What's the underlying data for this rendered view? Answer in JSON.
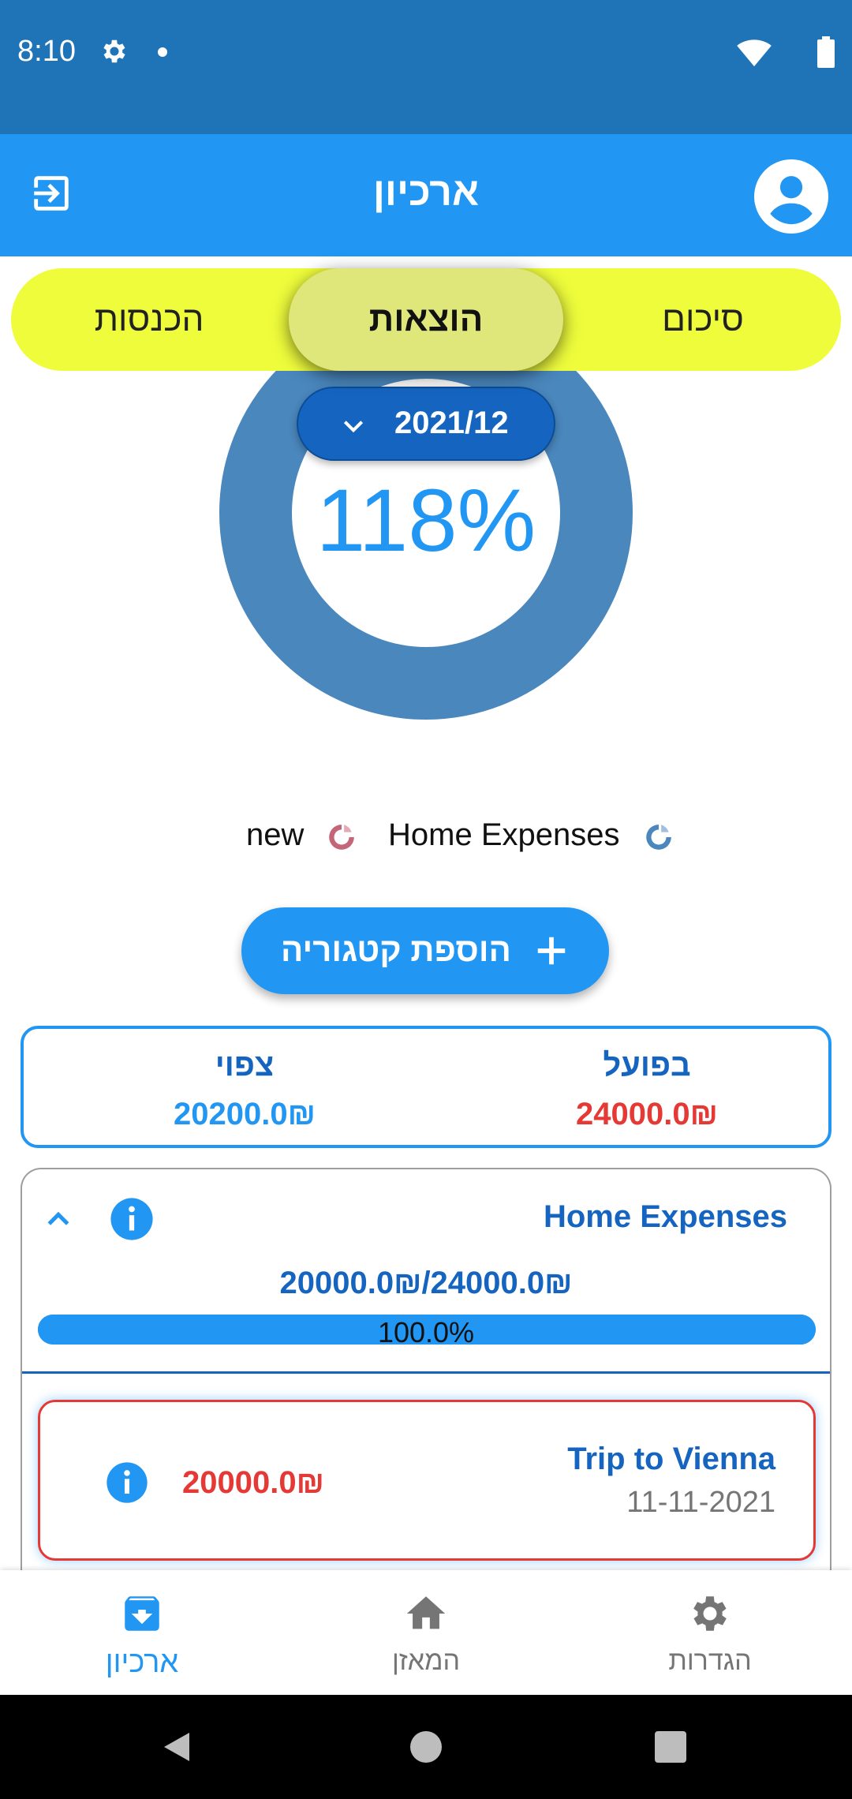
{
  "status_bar": {
    "time": "8:10"
  },
  "app_bar": {
    "title": "ארכיון"
  },
  "tabs": {
    "income": "הכנסות",
    "expenses": "הוצאות",
    "summary": "סיכום",
    "active": "expenses"
  },
  "chart": {
    "percent_label": "118%",
    "percent_value": 118,
    "ring_color": "#4a87bd"
  },
  "date_picker": {
    "value": "2021/12"
  },
  "legend": [
    {
      "label": "new",
      "color": "#c4667a"
    },
    {
      "label": "Home Expenses",
      "color": "#4a87bd"
    }
  ],
  "add_category_button": {
    "label": "הוספת קטגוריה"
  },
  "totals": {
    "expected_label": "צפוי",
    "expected_value": "20200.0₪",
    "actual_label": "בפועל",
    "actual_value": "24000.0₪"
  },
  "category": {
    "name": "Home Expenses",
    "amount": "20000.0₪/24000.0₪",
    "progress_label": "100.0%",
    "progress_fraction": 1.0,
    "items": [
      {
        "title": "Trip to Vienna",
        "date": "11-11-2021",
        "amount": "20000.0₪"
      }
    ]
  },
  "bottom_nav": {
    "archive": "ארכיון",
    "balance": "המאזן",
    "settings": "הגדרות",
    "active": "archive"
  },
  "colors": {
    "primary": "#2196f3",
    "dark_primary": "#1565c0",
    "accent_yellow": "#eefc3c",
    "danger": "#e53935"
  }
}
